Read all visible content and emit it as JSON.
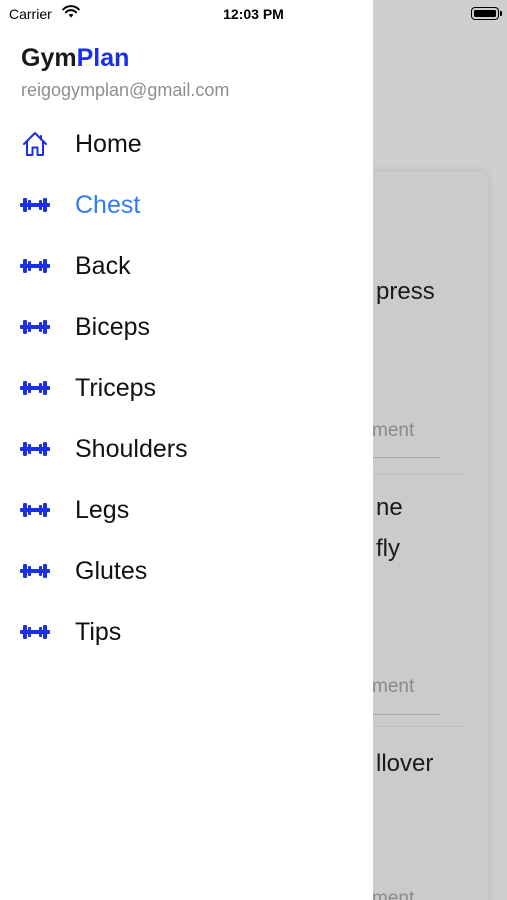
{
  "status_bar": {
    "carrier": "Carrier",
    "time": "12:03 PM",
    "wifi_icon": "wifi-icon",
    "battery_icon": "battery-icon"
  },
  "drawer": {
    "brand_part1": "Gym",
    "brand_part2": "Plan",
    "email": "reigogymplan@gmail.com",
    "accent_color": "#1a2fe6",
    "active_color": "#3479f5",
    "items": [
      {
        "label": "Home",
        "icon": "home-icon"
      },
      {
        "label": "Chest",
        "icon": "dumbbell-icon",
        "active": true
      },
      {
        "label": "Back",
        "icon": "dumbbell-icon"
      },
      {
        "label": "Biceps",
        "icon": "dumbbell-icon"
      },
      {
        "label": "Triceps",
        "icon": "dumbbell-icon"
      },
      {
        "label": "Shoulders",
        "icon": "dumbbell-icon"
      },
      {
        "label": "Legs",
        "icon": "dumbbell-icon"
      },
      {
        "label": "Glutes",
        "icon": "dumbbell-icon"
      },
      {
        "label": "Tips",
        "icon": "dumbbell-icon"
      }
    ]
  },
  "background": {
    "texts": [
      "press",
      "ment",
      "ne",
      "fly",
      "ment",
      "llover",
      "ment"
    ]
  }
}
